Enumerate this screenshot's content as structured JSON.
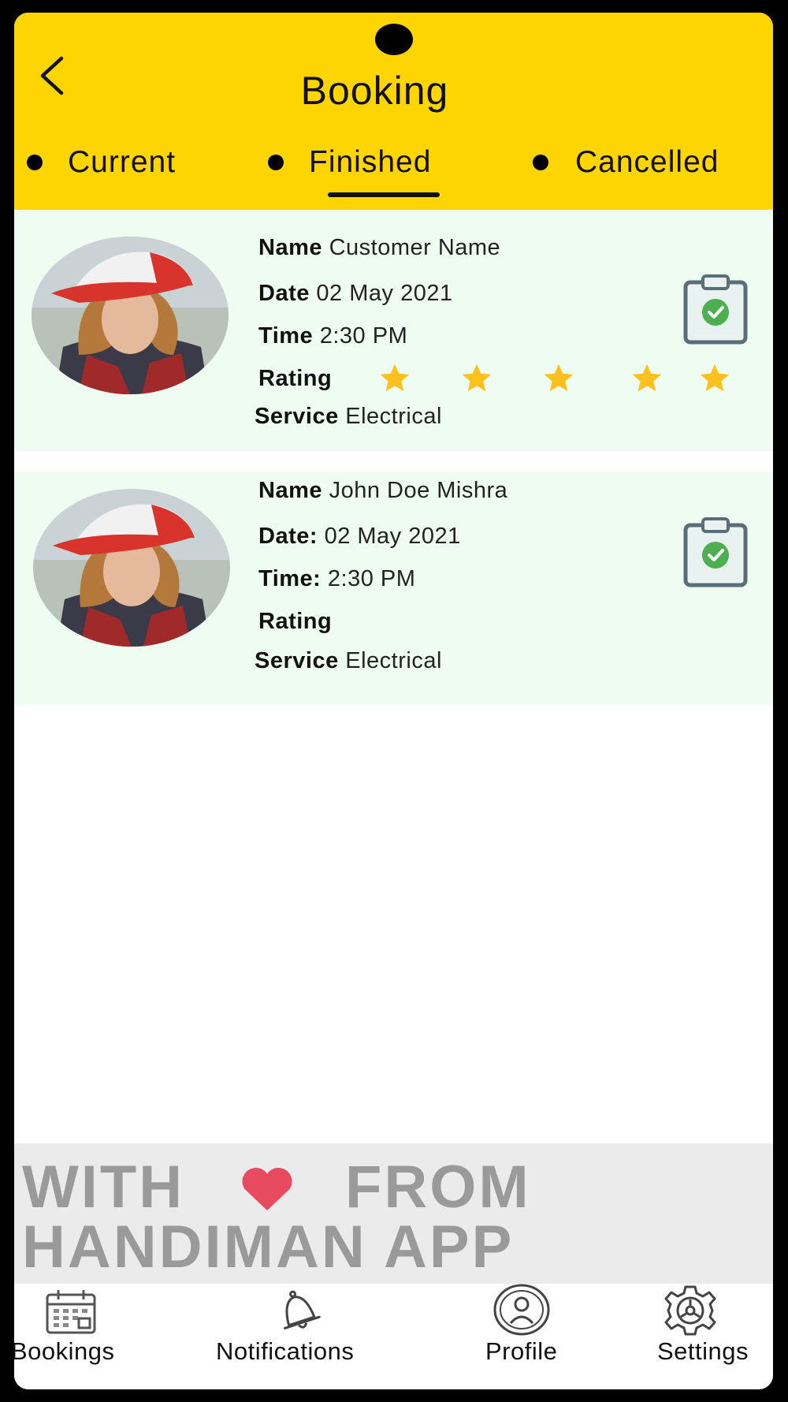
{
  "header": {
    "title": "Booking",
    "back_icon": "chevron-left-icon"
  },
  "tabs": [
    {
      "label": "Current",
      "active": false
    },
    {
      "label": "Finished",
      "active": true
    },
    {
      "label": "Cancelled",
      "active": false
    }
  ],
  "bookings": [
    {
      "name_label": "Name",
      "name": "Customer Name",
      "date_label": "Date",
      "date": "02 May 2021",
      "time_label": "Time",
      "time": "2:30 PM",
      "rating_label": "Rating",
      "rating": 5,
      "service_label": "Service",
      "service": "Electrical",
      "status_icon": "clipboard-check-icon"
    },
    {
      "name_label": "Name",
      "name": "John Doe Mishra",
      "date_label": "Date:",
      "date": "02 May 2021",
      "time_label": "Time:",
      "time": "2:30 PM",
      "rating_label": "Rating",
      "rating": 0,
      "service_label": "Service",
      "service": "Electrical",
      "status_icon": "clipboard-check-icon"
    }
  ],
  "banner": {
    "line1_left": "WITH",
    "line1_right": "FROM",
    "line2": "HANDIMAN APP",
    "heart_icon": "heart-icon"
  },
  "nav": [
    {
      "label": "Bookings",
      "icon": "calendar-icon"
    },
    {
      "label": "Notifications",
      "icon": "bell-icon"
    },
    {
      "label": "Profile",
      "icon": "user-circle-icon"
    },
    {
      "label": "Settings",
      "icon": "gear-icon"
    }
  ],
  "colors": {
    "header_bg": "#FFD500",
    "card_bg": "#EEFCF1",
    "star": "#FFC11E",
    "check": "#4CAF50",
    "heart": "#E84A5F",
    "banner_text": "#9A9A9A"
  }
}
